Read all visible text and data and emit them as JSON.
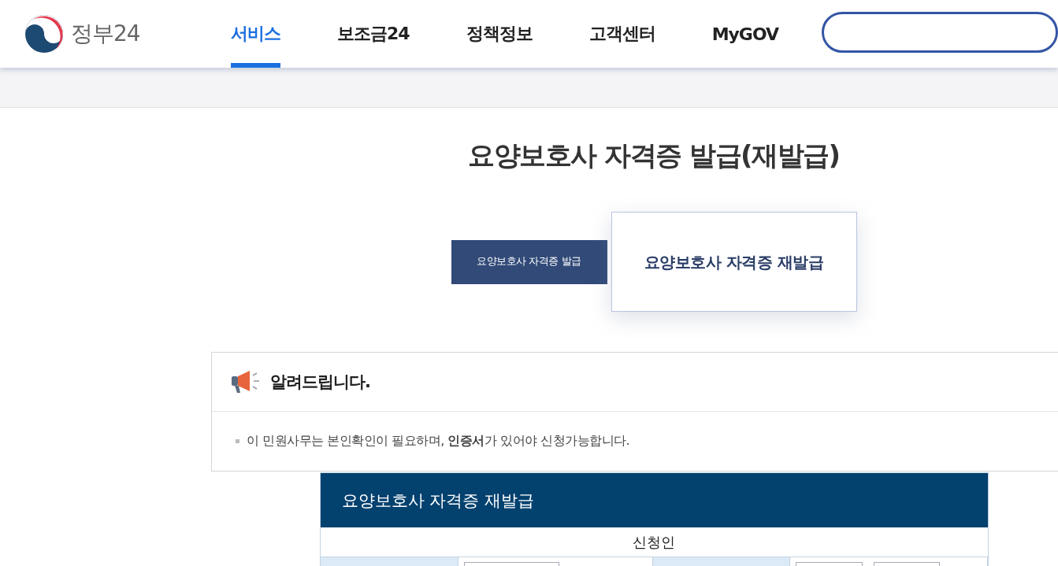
{
  "header": {
    "logo": "정부24",
    "nav": [
      {
        "label": "서비스",
        "selected": true
      },
      {
        "label": "보조금24",
        "selected": false
      },
      {
        "label": "정책정보",
        "selected": false
      },
      {
        "label": "고객센터",
        "selected": false
      },
      {
        "label": "MyGOV",
        "selected": false
      }
    ]
  },
  "page_title": "요양보호사 자격증 발급(재발급)",
  "tabs": [
    {
      "label": "요양보호사 자격증 발급",
      "selected": false
    },
    {
      "label": "요양보호사 자격증 재발급",
      "selected": true
    }
  ],
  "notice": {
    "title": "알려드립니다.",
    "items": [
      "이 민원사무는 본인확인이 필요하며, **인증서**가 있어야 신청가능합니다."
    ]
  },
  "form": {
    "title": "요양보호사 자격증 재발급",
    "section": "신청인"
  }
}
